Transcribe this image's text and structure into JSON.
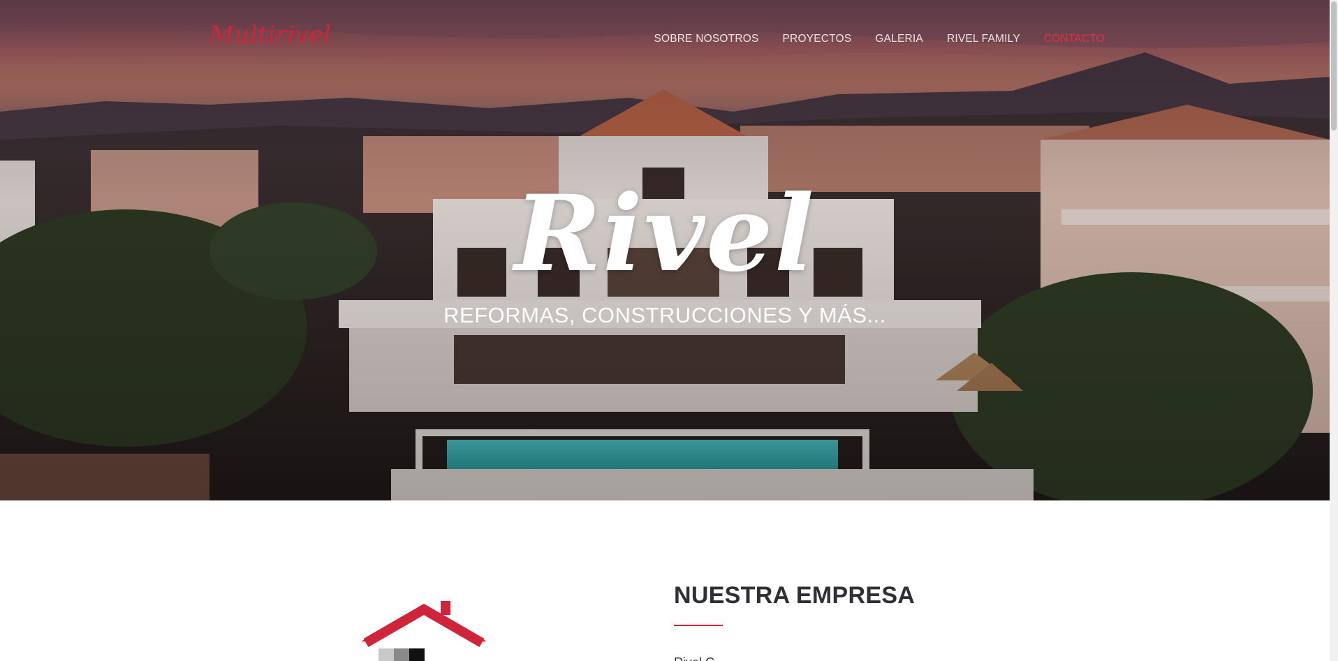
{
  "header": {
    "logo": "Multirivel",
    "nav": [
      {
        "label": "SOBRE NOSOTROS"
      },
      {
        "label": "PROYECTOS"
      },
      {
        "label": "GALERIA"
      },
      {
        "label": "RIVEL FAMILY"
      },
      {
        "label": "CONTACTO",
        "active": true
      }
    ]
  },
  "hero": {
    "title": "Rivel",
    "subtitle": "REFORMAS, CONSTRUCCIONES Y MÁS..."
  },
  "about": {
    "title": "NUESTRA EMPRESA",
    "text": "Rivel G..."
  },
  "colors": {
    "accent": "#d0243a",
    "nav_text": "#ece6e6",
    "heading": "#2f2f35"
  }
}
